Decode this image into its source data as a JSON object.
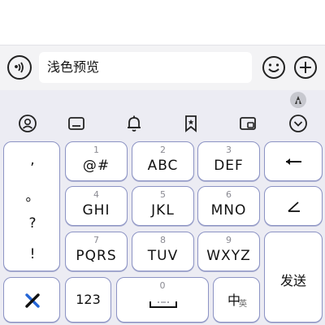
{
  "chat": {
    "input_value": "浅色预览"
  },
  "keyboard": {
    "punctuation": [
      ",",
      "。",
      "?",
      "!"
    ],
    "keys": [
      {
        "num": "1",
        "label": "@#"
      },
      {
        "num": "2",
        "label": "ABC"
      },
      {
        "num": "3",
        "label": "DEF"
      },
      {
        "num": "4",
        "label": "GHI"
      },
      {
        "num": "5",
        "label": "JKL"
      },
      {
        "num": "6",
        "label": "MNO"
      },
      {
        "num": "7",
        "label": "PQRS"
      },
      {
        "num": "8",
        "label": "TUV"
      },
      {
        "num": "9",
        "label": "WXYZ"
      }
    ],
    "send_label": "发送",
    "numbers_label": "123",
    "space_num": "0",
    "lang_main": "中",
    "lang_sub": "英"
  },
  "icons": {
    "voice": "voice-icon",
    "emoji": "emoji-icon",
    "plus": "plus-icon",
    "badge": "app-badge-icon",
    "toolbar": [
      "profile-icon",
      "keyboard-icon",
      "bell-icon",
      "bookmark-icon",
      "clipboard-icon",
      "chevron-down-icon"
    ],
    "backspace": "backspace-icon",
    "enter_symbol": "corner-icon",
    "logo": "x-logo-icon",
    "space": "space-icon"
  },
  "colors": {
    "key_border": "#8c93c4",
    "keyboard_bg": "#ececf3",
    "logo_blue": "#2566d6"
  }
}
